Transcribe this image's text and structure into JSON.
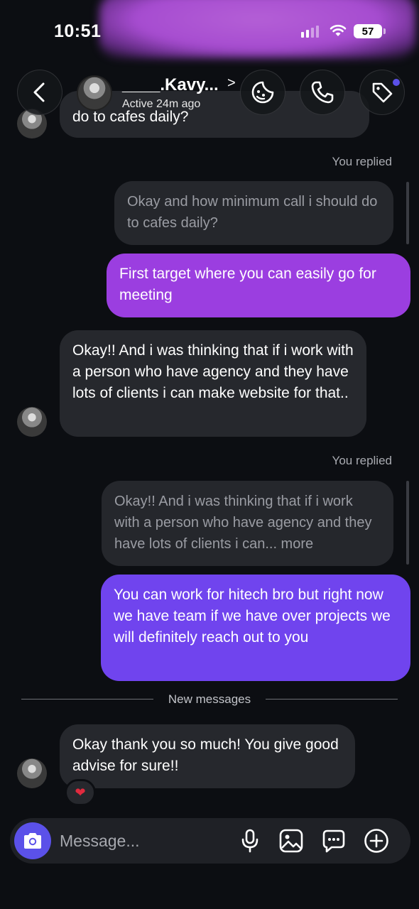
{
  "status_bar": {
    "time": "10:51",
    "battery": "57"
  },
  "header": {
    "contact_name": "____.Kavy...",
    "chevron": ">",
    "active_status": "Active 24m ago"
  },
  "messages": {
    "partial_top": "do to cafes daily?",
    "replied_label_1": "You replied",
    "quoted_1": "Okay and how minimum call i should do to cafes daily?",
    "out_1": "First target where you can easily go for meeting",
    "in_1": "Okay!! And i was thinking that if i work with a person who have agency and they have lots of clients i can make website for that..",
    "replied_label_2": "You replied",
    "quoted_2": "Okay!! And i was thinking that if i work with a person who have agency and they have lots of clients i can... more",
    "out_2": "You can work for hitech bro but right now we have team if we have over projects we will definitely reach out to you",
    "divider_label": "New messages",
    "in_2": "Okay thank you so much! You give good advise for sure!!",
    "reaction": "❤"
  },
  "composer": {
    "placeholder": "Message..."
  },
  "icons": [
    "back-icon",
    "sticker-icon",
    "phone-icon",
    "tag-icon",
    "camera-icon",
    "microphone-icon",
    "gallery-icon",
    "chat-options-icon",
    "plus-icon"
  ],
  "colors": {
    "outgoing_1": "#9b3ee0",
    "outgoing_2": "#7044ee",
    "incoming": "#26282d",
    "accent": "#5b51e9"
  }
}
